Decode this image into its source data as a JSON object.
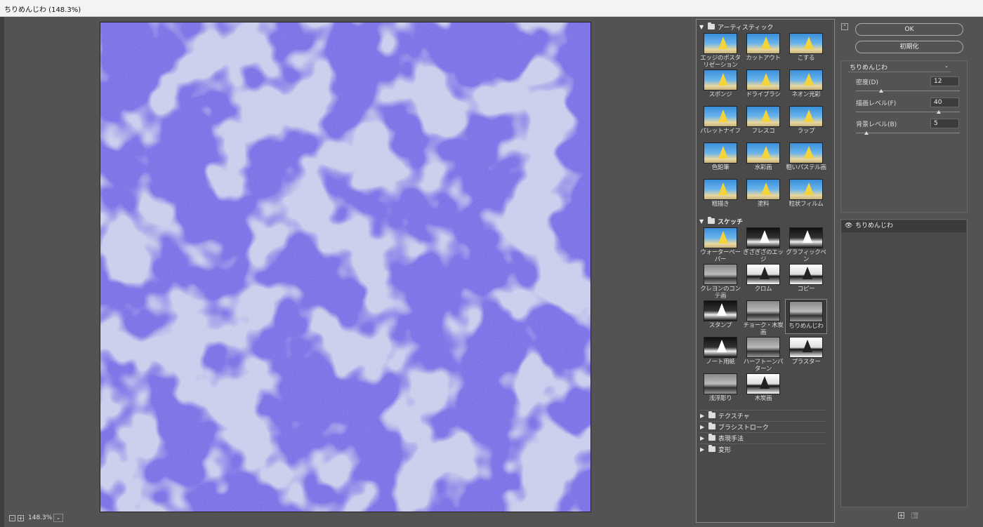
{
  "window": {
    "title": "ちりめんじわ (148.3%)"
  },
  "zoom": {
    "value": "148.3%",
    "minus": "-",
    "plus": "+",
    "dropdown": "⌄"
  },
  "gallery": {
    "artistic": {
      "label": "アーティスティック",
      "items": [
        "エッジのポスタリゼーション",
        "カットアウト",
        "こする",
        "スポンジ",
        "ドライブラシ",
        "ネオン光彩",
        "パレットナイフ",
        "フレスコ",
        "ラップ",
        "色鉛筆",
        "水彩画",
        "粗いパステル画",
        "粗描き",
        "塗料",
        "粒状フィルム"
      ]
    },
    "sketch": {
      "label": "スケッチ",
      "items": [
        "ウォーターペーパー",
        "ぎざぎざのエッジ",
        "グラフィックペン",
        "クレヨンのコンテ画",
        "クロム",
        "コピー",
        "スタンプ",
        "チョーク・木炭画",
        "ちりめんじわ",
        "ノート用紙",
        "ハーフトーンパターン",
        "プラスター",
        "浅浮彫り",
        "木炭画"
      ],
      "selected": "ちりめんじわ"
    },
    "collapsed": [
      "テクスチャ",
      "ブラシストローク",
      "表現手法",
      "変形"
    ]
  },
  "buttons": {
    "ok": "OK",
    "reset": "初期化",
    "collapse": "⌃"
  },
  "settings": {
    "filter": "ちりめんじわ",
    "params": [
      {
        "label": "密度(D)",
        "value": "12",
        "level": 0.24
      },
      {
        "label": "描画レベル(F)",
        "value": "40",
        "level": 0.8
      },
      {
        "label": "背景レベル(B)",
        "value": "5",
        "level": 0.1
      }
    ]
  },
  "layers": {
    "items": [
      {
        "name": "ちりめんじわ",
        "visible": true
      }
    ],
    "new": "+",
    "delete": "🗑"
  },
  "colors": {
    "accent": "#2a23e0",
    "pale": "#cfd4f7"
  }
}
